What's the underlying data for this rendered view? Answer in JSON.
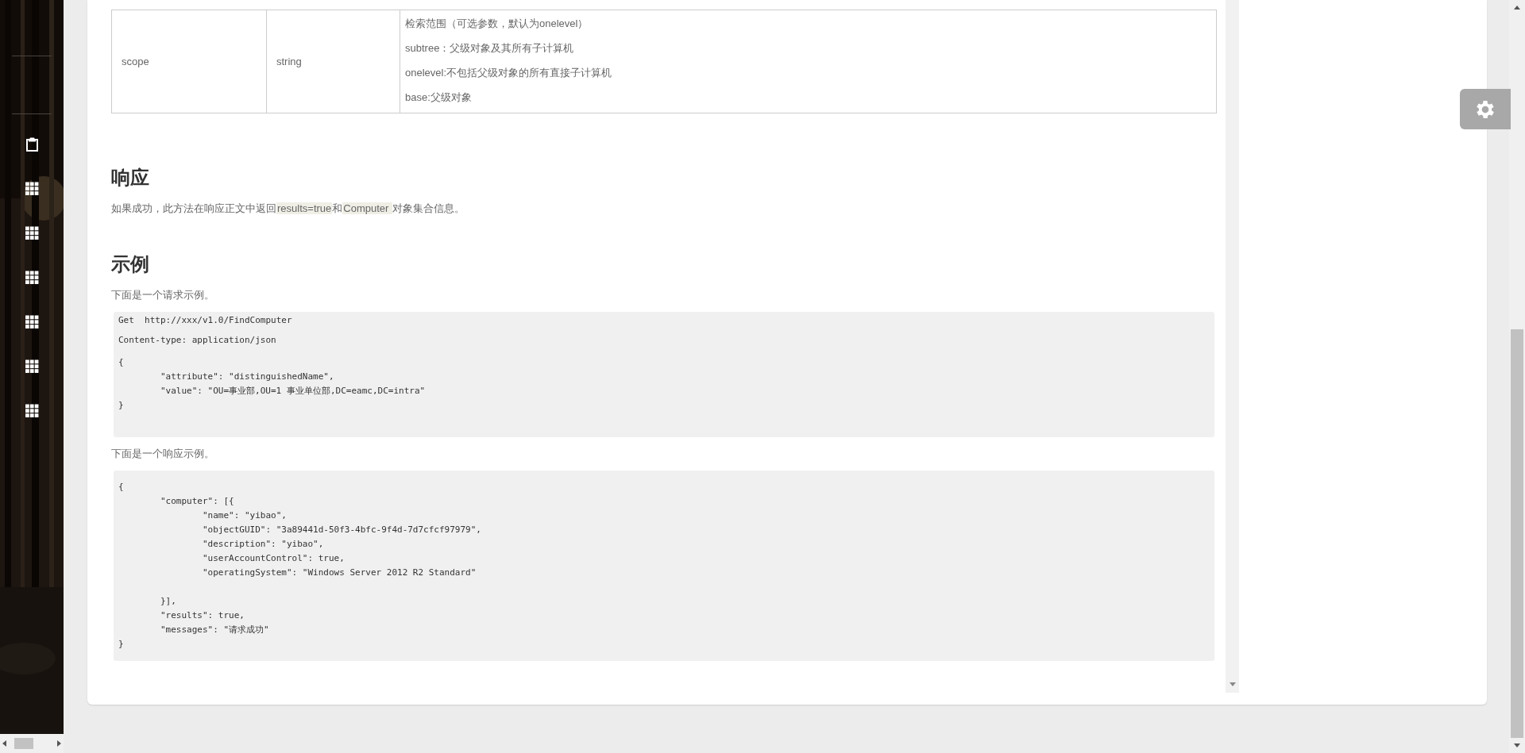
{
  "sidebar": {
    "icons": [
      {
        "kind": "clipboard"
      },
      {
        "kind": "grid"
      },
      {
        "kind": "grid"
      },
      {
        "kind": "grid"
      },
      {
        "kind": "grid"
      },
      {
        "kind": "grid"
      },
      {
        "kind": "grid"
      }
    ]
  },
  "param_table": {
    "rows": [
      {
        "name": "scope",
        "type": "string",
        "description": [
          "检索范围（可选参数，默认为onelevel）",
          "subtree：父级对象及其所有子计算机",
          "onelevel:不包括父级对象的所有直接子计算机",
          "base:父级对象"
        ]
      }
    ]
  },
  "sections": [
    {
      "heading": "响应",
      "blocks": [
        {
          "kind": "text",
          "segments": [
            {
              "kind": "plain",
              "text": "如果成功，此方法在响应正文中返回"
            },
            {
              "kind": "code",
              "text": "results=true"
            },
            {
              "kind": "plain",
              "text": "和"
            },
            {
              "kind": "code",
              "text": "Computer "
            },
            {
              "kind": "plain",
              "text": "对象集合信息。"
            }
          ]
        }
      ]
    },
    {
      "heading": "示例",
      "blocks": [
        {
          "kind": "text",
          "segments": [
            {
              "kind": "plain",
              "text": "下面是一个请求示例。"
            }
          ]
        },
        {
          "kind": "code",
          "groups": [
            [
              "Get  http://xxx/v1.0/FindComputer"
            ],
            [
              "Content-type: application/json"
            ],
            [
              "{",
              "\t\"attribute\": \"distinguishedName\",",
              "\t\"value\": \"OU=事业部,OU=1\t事业单位部,DC=eamc,DC=intra\"",
              "}"
            ]
          ]
        },
        {
          "kind": "text",
          "segments": [
            {
              "kind": "plain",
              "text": "下面是一个响应示例。"
            }
          ]
        },
        {
          "kind": "code",
          "groups": [
            [
              "{",
              "\t\"computer\": [{",
              "\t\t\"name\": \"yibao\",",
              "\t\t\"objectGUID\": \"3a89441d-50f3-4bfc-9f4d-7d7cfcf97979\",",
              "\t\t\"description\": \"yibao\",",
              "\t\t\"userAccountControl\": true,",
              "\t\t\"operatingSystem\": \"Windows Server 2012 R2 Standard\""
            ],
            [
              "\t}],",
              "\t\"results\": true,",
              "\t\"messages\": \"请求成功\"",
              "}"
            ]
          ]
        }
      ]
    }
  ]
}
